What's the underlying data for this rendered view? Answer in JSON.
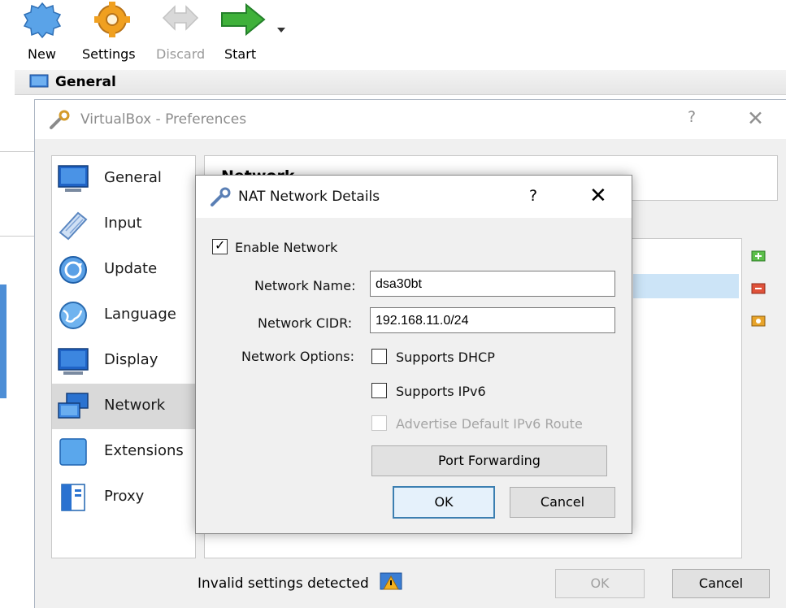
{
  "toolbar": {
    "new_label": "New",
    "settings_label": "Settings",
    "discard_label": "Discard",
    "start_label": "Start"
  },
  "manager": {
    "section_title": "General"
  },
  "preferences": {
    "title": "VirtualBox - Preferences",
    "help_glyph": "?",
    "close_glyph": "✕",
    "page_header": "Network",
    "nav": [
      {
        "label": "General",
        "icon": "general-icon"
      },
      {
        "label": "Input",
        "icon": "input-icon"
      },
      {
        "label": "Update",
        "icon": "update-icon"
      },
      {
        "label": "Language",
        "icon": "language-icon"
      },
      {
        "label": "Display",
        "icon": "display-icon"
      },
      {
        "label": "Network",
        "icon": "network-icon"
      },
      {
        "label": "Extensions",
        "icon": "extensions-icon"
      },
      {
        "label": "Proxy",
        "icon": "proxy-icon"
      }
    ],
    "selected_nav": "Network",
    "status_text": "Invalid settings detected",
    "ok_label": "OK",
    "cancel_label": "Cancel"
  },
  "nat_dialog": {
    "title": "NAT Network Details",
    "help_glyph": "?",
    "close_glyph": "✕",
    "enable_network_label": "Enable Network",
    "enable_network_checked": true,
    "network_name_label": "Network Name:",
    "network_name_value": "dsa30bt",
    "network_cidr_label": "Network CIDR:",
    "network_cidr_value": "192.168.11.0/24",
    "network_options_label": "Network Options:",
    "supports_dhcp_label": "Supports DHCP",
    "supports_dhcp_checked": false,
    "supports_ipv6_label": "Supports IPv6",
    "supports_ipv6_checked": false,
    "advertise_ipv6_label": "Advertise Default IPv6 Route",
    "advertise_ipv6_checked": false,
    "port_forwarding_label": "Port Forwarding",
    "ok_label": "OK",
    "cancel_label": "Cancel"
  },
  "colors": {
    "accent": "#3c7fb1",
    "selection": "#cce4f7",
    "start_arrow": "#3fb13a",
    "settings_gear": "#f0a020"
  }
}
